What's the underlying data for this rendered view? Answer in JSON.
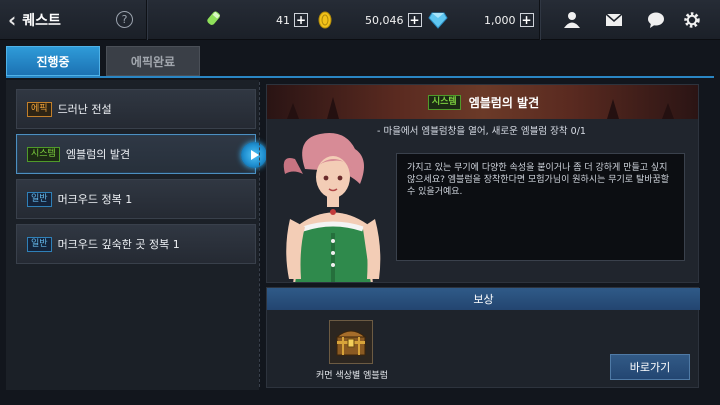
{
  "header": {
    "title": "퀘스트",
    "help_label": "?",
    "stamina": "41",
    "gold": "50,046",
    "gems": "1,000",
    "plus_label": "+"
  },
  "tabs": [
    {
      "label": "진행중",
      "active": true
    },
    {
      "label": "에픽완료",
      "active": false
    }
  ],
  "quests": [
    {
      "badge": "에픽",
      "badge_type": "epic",
      "title": "드러난 전설"
    },
    {
      "badge": "시스템",
      "badge_type": "system",
      "title": "엠블럼의 발견",
      "selected": true
    },
    {
      "badge": "일반",
      "badge_type": "normal",
      "title": "머크우드 정복 1"
    },
    {
      "badge": "일반",
      "badge_type": "normal",
      "title": "머크우드 깊숙한 곳 정복 1"
    }
  ],
  "detail": {
    "badge": "시스템",
    "title": "엠블럼의 발견",
    "objective": "- 마을에서 엠블럼창을 열어, 새로운 엠블럼 장착 0/1",
    "dialog": "가지고 있는 무기에 다양한 속성을 붙이거나 좀 더 강하게 만들고 싶지 않으세요?  엠블럼을 장착한다면 모험가님이 원하시는 무기로 탈바꿈할 수 있을거예요."
  },
  "reward": {
    "header": "보상",
    "item_name": "커먼 색상별 엠블럼",
    "button_label": "바로가기"
  },
  "colors": {
    "accent_blue": "#2a86c4",
    "epic": "#f0a33a",
    "system": "#7ccf3f",
    "normal": "#63b5e8"
  },
  "icons": [
    "back-chevron-icon",
    "help-icon",
    "potion-icon",
    "coin-icon",
    "gem-icon",
    "friends-icon",
    "mail-icon",
    "chat-icon",
    "settings-gear-icon",
    "treasure-chest-icon",
    "play-arrow-icon"
  ]
}
